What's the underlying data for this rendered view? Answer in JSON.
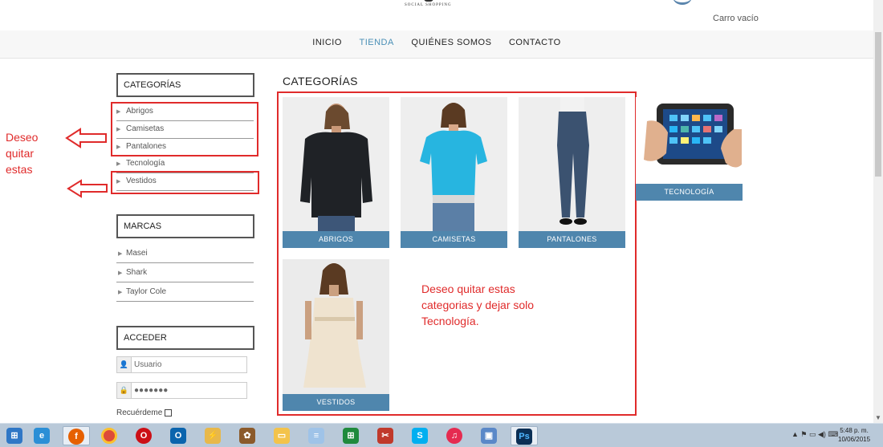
{
  "header": {
    "logo_subtitle": "SOCIAL SHOPPING",
    "cart_text": "Carro vacío"
  },
  "nav": {
    "items": [
      "INICIO",
      "TIENDA",
      "QUIÉNES SOMOS",
      "CONTACTO"
    ],
    "active": "TIENDA"
  },
  "sidebar": {
    "categories_title": "CATEGORÍAS",
    "categories": [
      "Abrigos",
      "Camisetas",
      "Pantalones",
      "Tecnología",
      "Vestidos"
    ],
    "brands_title": "MARCAS",
    "brands": [
      "Masei",
      "Shark",
      "Taylor Cole"
    ],
    "login_title": "ACCEDER",
    "username_placeholder": "Usuario",
    "password_value": "●●●●●●●",
    "remember_label": "Recuérdeme"
  },
  "annotations": {
    "left_note_lines": [
      "Deseo",
      "quitar",
      "estas"
    ],
    "center_note_lines": [
      "Deseo quitar estas",
      "categorias y dejar solo",
      "Tecnología."
    ]
  },
  "main": {
    "title": "CATEGORÍAS",
    "cards": [
      {
        "label": "ABRIGOS",
        "icon": "jacket-image"
      },
      {
        "label": "CAMISETAS",
        "icon": "tshirt-image"
      },
      {
        "label": "PANTALONES",
        "icon": "jeans-image"
      },
      {
        "label": "TECNOLOGÍA",
        "icon": "tablet-image"
      },
      {
        "label": "VESTIDOS",
        "icon": "dress-image"
      }
    ]
  },
  "taskbar": {
    "apps": [
      "start",
      "internet-explorer",
      "firefox",
      "chrome",
      "opera",
      "outlook",
      "winamp",
      "gimp",
      "explorer",
      "notepad",
      "excel",
      "snipping-tool",
      "skype",
      "itunes",
      "photo-viewer",
      "photoshop"
    ],
    "time": "5:48 p. m.",
    "date": "10/06/2015"
  },
  "colors": {
    "accent": "#4f86ad",
    "annotation": "#e02b2b",
    "nav_active": "#4a8fb6"
  }
}
